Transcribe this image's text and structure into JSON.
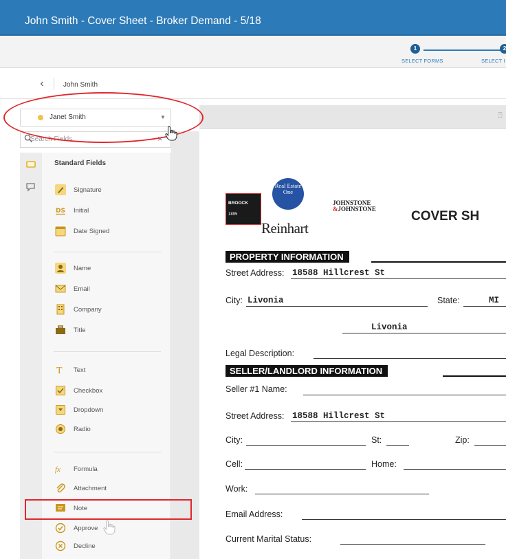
{
  "window": {
    "title": "John Smith - Cover Sheet - Broker Demand - 5/18"
  },
  "steps": [
    {
      "number": "1",
      "label": "SELECT FORMS"
    },
    {
      "number": "2",
      "label": "SELECT I"
    }
  ],
  "breadcrumb": {
    "name": "John Smith"
  },
  "signer": {
    "name": "Janet Smith"
  },
  "search": {
    "placeholder": "Search Fields"
  },
  "standard_fields": {
    "header": "Standard Fields",
    "groups": [
      [
        {
          "label": "Signature",
          "icon": "pen-icon",
          "color": "#e3b12c"
        },
        {
          "label": "Initial",
          "icon": "ds-icon",
          "color": "#e3b12c"
        },
        {
          "label": "Date Signed",
          "icon": "calendar-icon",
          "color": "#e3b12c"
        }
      ],
      [
        {
          "label": "Name",
          "icon": "person-icon",
          "color": "#e3b12c"
        },
        {
          "label": "Email",
          "icon": "envelope-icon",
          "color": "#e3b12c"
        },
        {
          "label": "Company",
          "icon": "building-icon",
          "color": "#e3b12c"
        },
        {
          "label": "Title",
          "icon": "briefcase-icon",
          "color": "#e3b12c"
        }
      ],
      [
        {
          "label": "Text",
          "icon": "text-icon",
          "color": "#e3b12c"
        },
        {
          "label": "Checkbox",
          "icon": "checkbox-icon",
          "color": "#e3b12c"
        },
        {
          "label": "Dropdown",
          "icon": "dropdown-icon",
          "color": "#e3b12c"
        },
        {
          "label": "Radio",
          "icon": "radio-icon",
          "color": "#e3b12c"
        }
      ],
      [
        {
          "label": "Formula",
          "icon": "fx-icon",
          "color": "#e3b12c"
        },
        {
          "label": "Attachment",
          "icon": "paperclip-icon",
          "color": "#e3b12c"
        },
        {
          "label": "Note",
          "icon": "note-icon",
          "color": "#e3b12c"
        },
        {
          "label": "Approve",
          "icon": "check-circle-icon",
          "color": "#e3b12c"
        },
        {
          "label": "Decline",
          "icon": "x-circle-icon",
          "color": "#e3b12c"
        }
      ]
    ]
  },
  "document": {
    "logos": {
      "broock_line1": "BROOCK",
      "broock_line2": "1895",
      "re_text": "Real Estate One",
      "reinhart": "Reinhart",
      "johnstone_top": "JOHNSTONE",
      "johnstone_amp": "&",
      "johnstone_bottom": "JOHNSTONE"
    },
    "title": "COVER SH",
    "property_section": "PROPERTY INFORMATION",
    "seller_section": "SELLER/LANDLORD INFORMATION",
    "street_label": "Street Address:",
    "street_value": "18588 Hillcrest St",
    "city_label": "City:",
    "city_value": "Livonia",
    "state_label": "State:",
    "state_value": "MI",
    "township_value": "Livonia",
    "legal_label": "Legal Description:",
    "seller1_label": "Seller #1 Name:",
    "seller_street_label": "Street Address:",
    "seller_street_value": "18588 Hillcrest St",
    "seller_city_label": "City:",
    "st_label": "St:",
    "zip_label": "Zip:",
    "cell_label": "Cell:",
    "home_label": "Home:",
    "work_label": "Work:",
    "email_label": "Email Address:",
    "marital_label": "Current Marital Status:"
  },
  "colors": {
    "title_bar": "#2c7ab8",
    "accent": "#e3b12c",
    "highlight": "#e0262b"
  }
}
